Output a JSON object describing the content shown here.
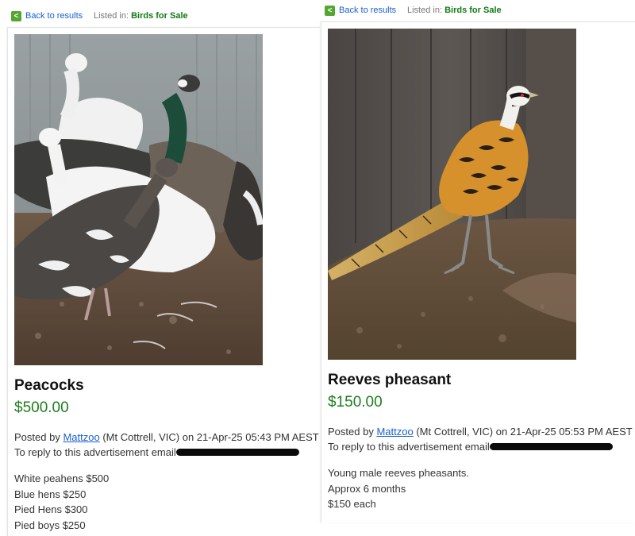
{
  "nav": {
    "back_label": "Back to results",
    "back_icon": "arrow-left-icon",
    "listed_in_label": "Listed in:",
    "category": "Birds for Sale"
  },
  "colors": {
    "accent_green": "#55a630",
    "price_green": "#1e7e1e",
    "link_blue": "#1a5fd0"
  },
  "listings": [
    {
      "title": "Peacocks",
      "price": "$500.00",
      "posted_prefix": "Posted by",
      "poster": "Mattzoo",
      "posted_suffix": "(Mt Cottrell, VIC) on 21-Apr-25 05:43 PM AEST",
      "reply_text": "To reply to this advertisement email",
      "description": [
        "White peahens $500",
        "Blue hens $250",
        "Pied Hens $300",
        "Pied boys $250"
      ],
      "photo_icon": "peacocks-photo"
    },
    {
      "title": "Reeves pheasant",
      "price": "$150.00",
      "posted_prefix": "Posted by",
      "poster": "Mattzoo",
      "posted_suffix": "(Mt Cottrell, VIC) on 21-Apr-25 05:53 PM AEST",
      "reply_text": "To reply to this advertisement email",
      "description": [
        "Young male reeves pheasants.",
        "Approx 6 months",
        "$150 each"
      ],
      "photo_icon": "pheasant-photo"
    }
  ]
}
